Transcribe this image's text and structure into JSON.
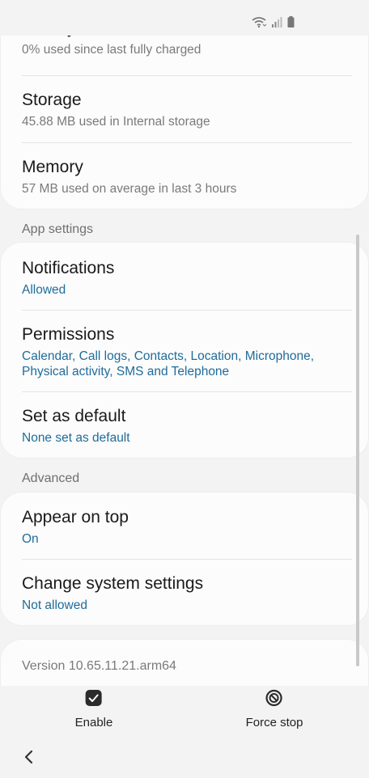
{
  "status_bar": {
    "icons": [
      "wifi-icon",
      "signal-icon",
      "battery-icon"
    ]
  },
  "top_card": {
    "battery": {
      "title": "Battery",
      "subtitle": "0% used since last fully charged"
    },
    "storage": {
      "title": "Storage",
      "subtitle": "45.88 MB used in Internal storage"
    },
    "memory": {
      "title": "Memory",
      "subtitle": "57 MB used on average in last 3 hours"
    }
  },
  "app_settings": {
    "header": "App settings",
    "notifications": {
      "title": "Notifications",
      "subtitle": "Allowed"
    },
    "permissions": {
      "title": "Permissions",
      "subtitle": "Calendar, Call logs, Contacts, Location, Microphone, Physical activity, SMS and Telephone"
    },
    "set_as_default": {
      "title": "Set as default",
      "subtitle": "None set as default"
    }
  },
  "advanced": {
    "header": "Advanced",
    "appear_on_top": {
      "title": "Appear on top",
      "subtitle": "On"
    },
    "change_system_settings": {
      "title": "Change system settings",
      "subtitle": "Not allowed"
    }
  },
  "version": {
    "text": "Version 10.65.11.21.arm64"
  },
  "bottom_actions": {
    "enable_label": "Enable",
    "force_stop_label": "Force stop"
  },
  "colors": {
    "accent_blue": "#1f6c9a",
    "background": "#f3f3f3",
    "card": "#fcfcfc"
  }
}
